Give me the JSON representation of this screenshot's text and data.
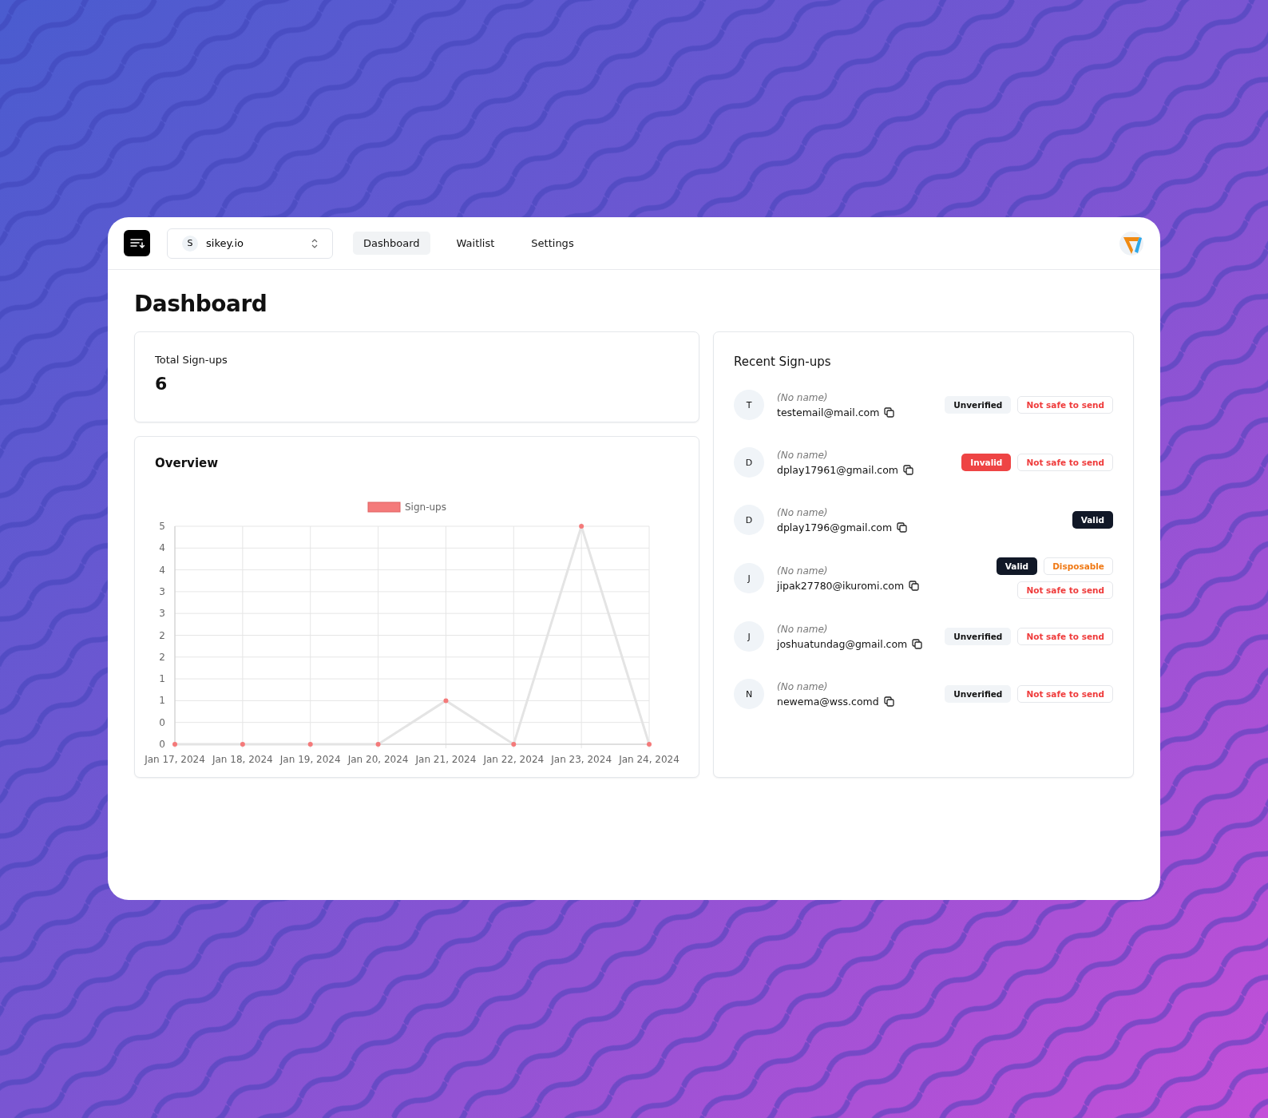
{
  "header": {
    "project": {
      "initial": "S",
      "name": "sikey.io"
    },
    "tabs": [
      {
        "label": "Dashboard",
        "selected": true
      },
      {
        "label": "Waitlist",
        "selected": false
      },
      {
        "label": "Settings",
        "selected": false
      }
    ]
  },
  "page_title": "Dashboard",
  "total_signups": {
    "label": "Total Sign-ups",
    "value": "6"
  },
  "overview": {
    "title": "Overview",
    "chart_data": {
      "type": "line",
      "categories": [
        "Jan 17, 2024",
        "Jan 18, 2024",
        "Jan 19, 2024",
        "Jan 20, 2024",
        "Jan 21, 2024",
        "Jan 22, 2024",
        "Jan 23, 2024",
        "Jan 24, 2024"
      ],
      "series": [
        {
          "name": "Sign-ups",
          "color": "#f47a7a",
          "marker": true,
          "values": [
            0,
            0,
            0,
            0,
            1,
            0,
            5,
            0
          ]
        }
      ],
      "ylim": [
        0,
        5
      ],
      "grid": true,
      "yticks": [
        0,
        {
          "value": 0.5,
          "label": "0"
        },
        1,
        {
          "value": 1.5,
          "label": "1"
        },
        2,
        {
          "value": 2.5,
          "label": "2"
        },
        3,
        {
          "value": 3.5,
          "label": "3"
        },
        4,
        {
          "value": 4.5,
          "label": "4"
        },
        5
      ]
    }
  },
  "recent": {
    "title": "Recent Sign-ups",
    "items": [
      {
        "initial": "T",
        "name": "(No name)",
        "email": "testemail@mail.com",
        "badges": [
          {
            "kind": "unverified",
            "text": "Unverified"
          },
          {
            "kind": "unsafe",
            "text": "Not safe to send"
          }
        ]
      },
      {
        "initial": "D",
        "name": "(No name)",
        "email": "dplay17961@gmail.com",
        "badges": [
          {
            "kind": "invalid",
            "text": "Invalid"
          },
          {
            "kind": "unsafe",
            "text": "Not safe to send"
          }
        ]
      },
      {
        "initial": "D",
        "name": "(No name)",
        "email": "dplay1796@gmail.com",
        "badges": [
          {
            "kind": "valid",
            "text": "Valid"
          }
        ]
      },
      {
        "initial": "J",
        "name": "(No name)",
        "email": "jipak27780@ikuromi.com",
        "badges": [
          {
            "kind": "valid",
            "text": "Valid"
          },
          {
            "kind": "disposable",
            "text": "Disposable"
          },
          {
            "kind": "unsafe",
            "text": "Not safe to send"
          }
        ]
      },
      {
        "initial": "J",
        "name": "(No name)",
        "email": "joshuatundag@gmail.com",
        "badges": [
          {
            "kind": "unverified",
            "text": "Unverified"
          },
          {
            "kind": "unsafe",
            "text": "Not safe to send"
          }
        ]
      },
      {
        "initial": "N",
        "name": "(No name)",
        "email": "newema@wss.comd",
        "badges": [
          {
            "kind": "unverified",
            "text": "Unverified"
          },
          {
            "kind": "unsafe",
            "text": "Not safe to send"
          }
        ]
      }
    ]
  }
}
